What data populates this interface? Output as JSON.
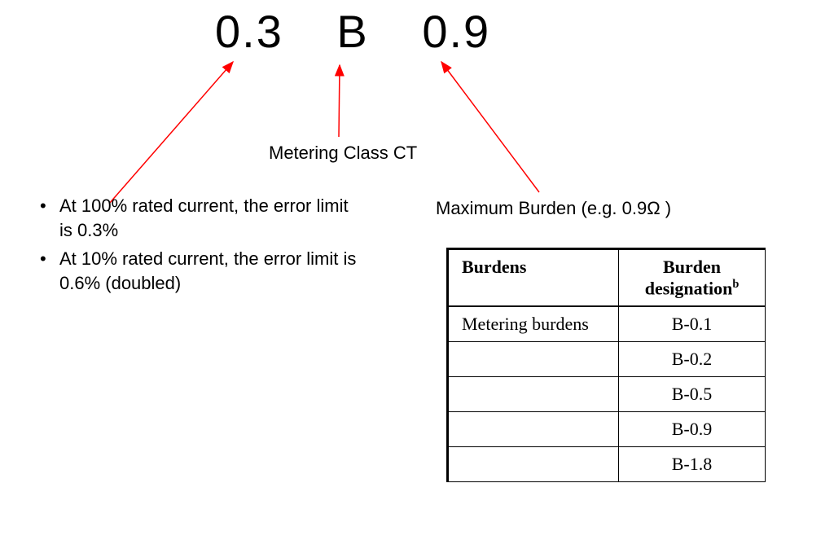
{
  "title": {
    "part1": "0.3",
    "part2": "B",
    "part3": "0.9"
  },
  "labels": {
    "metering": "Metering Class CT",
    "maxburden": "Maximum Burden (e.g. 0.9Ω )"
  },
  "bullets": {
    "b1": "At 100% rated current, the error limit is 0.3%",
    "b2": "At 10% rated current, the error limit is 0.6% (doubled)"
  },
  "table": {
    "header1": "Burdens",
    "header2_main": "Burden designation",
    "header2_sup": "b",
    "rows": [
      {
        "c1": "Metering burdens",
        "c2": "B-0.1"
      },
      {
        "c1": "",
        "c2": "B-0.2"
      },
      {
        "c1": "",
        "c2": "B-0.5"
      },
      {
        "c1": "",
        "c2": "B-0.9"
      },
      {
        "c1": "",
        "c2": "B-1.8"
      }
    ]
  }
}
